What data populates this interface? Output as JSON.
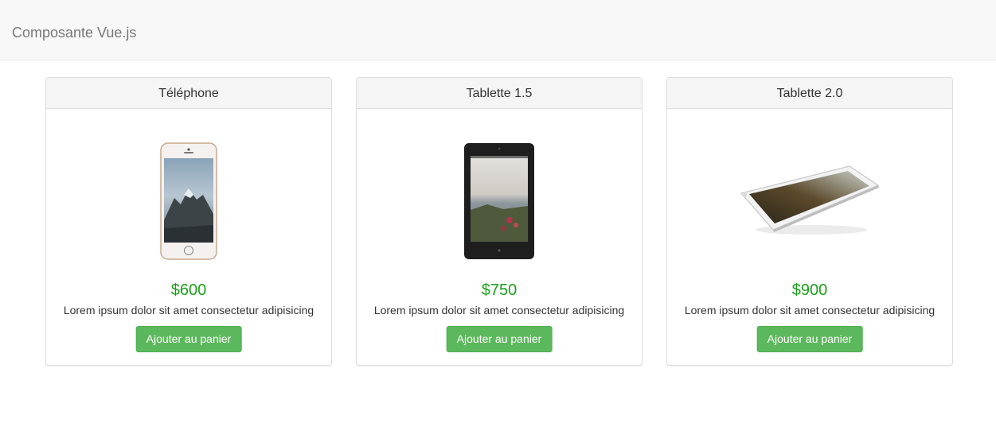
{
  "navbar": {
    "brand": "Composante Vue.js"
  },
  "products": [
    {
      "name": "Téléphone",
      "image": "smartphone-image",
      "price": "$600",
      "description": "Lorem ipsum dolor sit amet consectetur adipisicing",
      "button_label": "Ajouter au panier"
    },
    {
      "name": "Tablette 1.5",
      "image": "tablet-image",
      "price": "$750",
      "description": "Lorem ipsum dolor sit amet consectetur adipisicing",
      "button_label": "Ajouter au panier"
    },
    {
      "name": "Tablette 2.0",
      "image": "tablet-landscape-image",
      "price": "$900",
      "description": "Lorem ipsum dolor sit amet consectetur adipisicing",
      "button_label": "Ajouter au panier"
    }
  ],
  "colors": {
    "price": "#1aa01a",
    "button": "#5cb85c",
    "navbar": "#f8f8f8"
  }
}
